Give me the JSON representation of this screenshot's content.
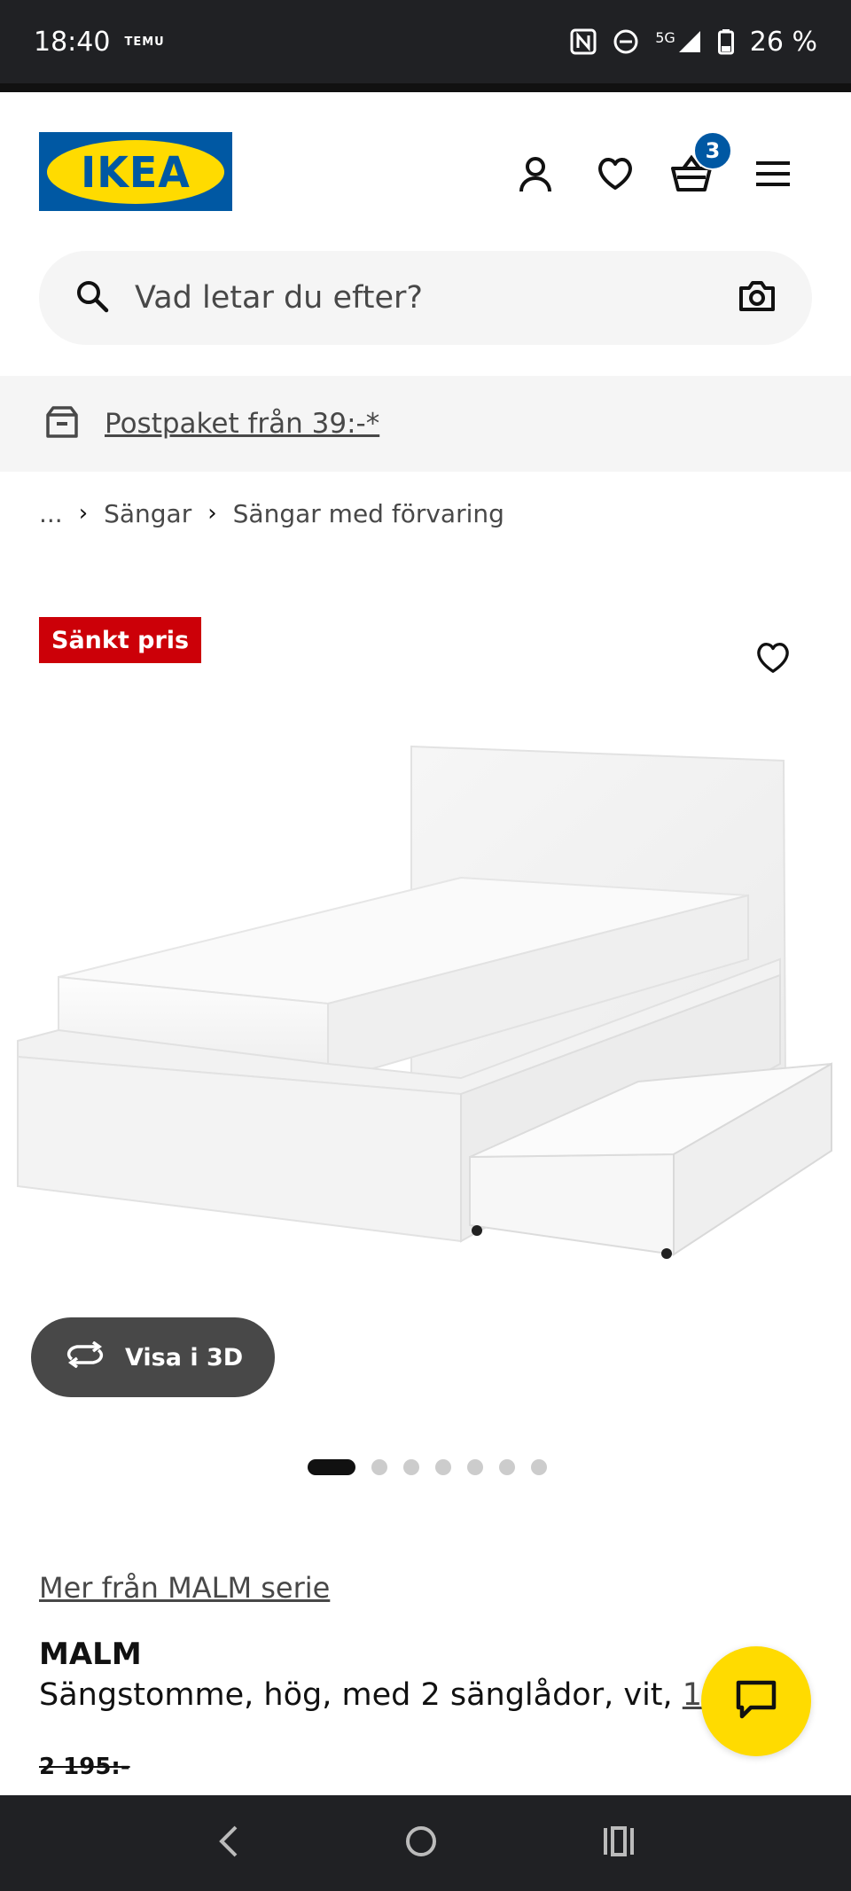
{
  "status_bar": {
    "time": "18:40",
    "app_indicator": "TEMU",
    "network": "5G",
    "battery": "26 %"
  },
  "header": {
    "logo_text": "IKEA",
    "cart_count": "3",
    "icons": [
      "user-icon",
      "heart-icon",
      "cart-icon",
      "menu-icon"
    ]
  },
  "search": {
    "placeholder": "Vad letar du efter?"
  },
  "promo": {
    "text": "Postpaket från 39:-*"
  },
  "breadcrumb": {
    "items": [
      "...",
      "Sängar",
      "Sängar med förvaring"
    ]
  },
  "product": {
    "tag": "Sänkt pris",
    "view3d_label": "Visa i 3D",
    "image_count": 7,
    "active_image": 1,
    "series_link": "Mer från MALM serie",
    "name": "MALM",
    "description": "Sängstomme, hög, med 2 sänglådor, vit, ",
    "size_link": "120x",
    "old_price": "2 195:-"
  },
  "colors": {
    "ikea_blue": "#0058a3",
    "ikea_yellow": "#ffdb00",
    "sale_red": "#cc0008"
  }
}
